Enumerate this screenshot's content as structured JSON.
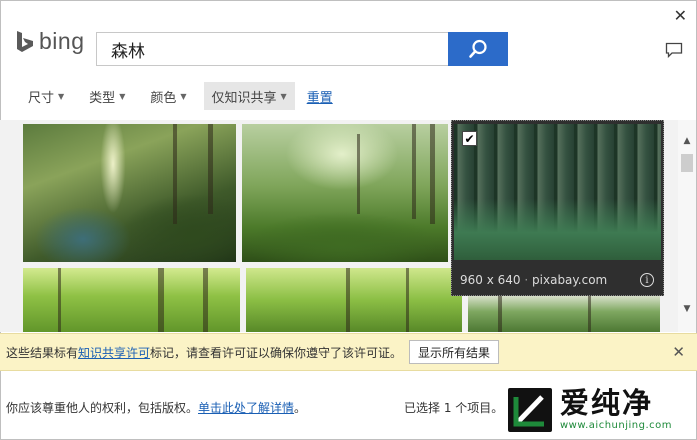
{
  "window": {
    "close_glyph": "✕"
  },
  "header": {
    "logo_text": "bing",
    "search_value": "森林",
    "search_icon": "search-icon",
    "feedback_icon": "feedback-icon"
  },
  "filters": {
    "items": [
      {
        "label": "尺寸"
      },
      {
        "label": "类型"
      },
      {
        "label": "颜色"
      },
      {
        "label": "仅知识共享"
      }
    ],
    "reset_label": "重置"
  },
  "selected_image": {
    "checkbox": "✔",
    "dimensions": "960 x 640",
    "separator": "·",
    "source": "pixabay.com",
    "info_glyph": "i"
  },
  "scrollbar": {
    "up": "▲",
    "down": "▼"
  },
  "license_bar": {
    "text_before": "这些结果标有",
    "link": "知识共享许可",
    "text_after": "标记，请查看许可证以确保你遵守了该许可证。",
    "button": "显示所有结果",
    "close_glyph": "✕"
  },
  "footer": {
    "note_text": "你应该尊重他人的权利，包括版权。",
    "note_link": "单击此处了解详情",
    "note_end": "。",
    "selection_count": "已选择 1 个项目。"
  },
  "watermark": {
    "name": "爱纯净",
    "url": "www.aichunjing.com"
  },
  "colors": {
    "accent": "#2c6bc9",
    "link": "#1a5fb4",
    "license_bg": "#fbf3c6",
    "watermark_green": "#1e8a3a"
  }
}
